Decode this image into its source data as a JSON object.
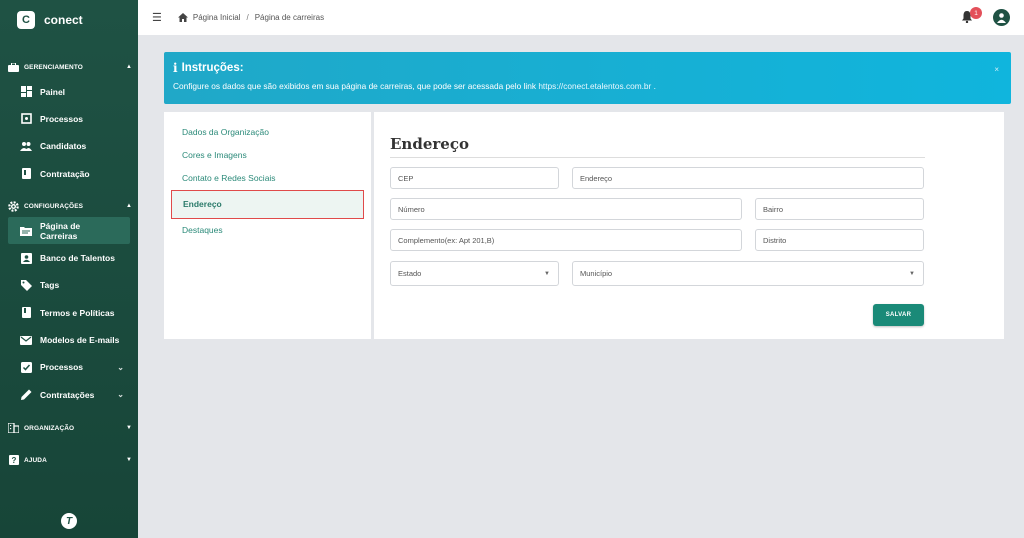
{
  "brand": {
    "letter": "C",
    "name": "conect"
  },
  "sidebar": {
    "sections": [
      {
        "label": "GERENCIAMENTO",
        "icon": "briefcase-icon"
      },
      {
        "label": "CONFIGURAÇÕES",
        "icon": "gear-icon"
      },
      {
        "label": "ORGANIZAÇÃO",
        "icon": "building-icon"
      },
      {
        "label": "AJUDA",
        "icon": "help-icon"
      }
    ],
    "management_items": [
      {
        "label": "Painel",
        "icon": "dashboard-icon"
      },
      {
        "label": "Processos",
        "icon": "process-icon"
      },
      {
        "label": "Candidatos",
        "icon": "people-icon"
      },
      {
        "label": "Contratação",
        "icon": "contract-icon"
      }
    ],
    "config_items": [
      {
        "label": "Página de Carreiras",
        "icon": "folder-icon"
      },
      {
        "label": "Banco de Talentos",
        "icon": "contact-card-icon"
      },
      {
        "label": "Tags",
        "icon": "tag-icon"
      },
      {
        "label": "Termos e Políticas",
        "icon": "book-icon"
      },
      {
        "label": "Modelos de E-mails",
        "icon": "mail-icon"
      },
      {
        "label": "Processos",
        "icon": "checkbox-icon"
      },
      {
        "label": "Contratações",
        "icon": "pen-icon"
      }
    ],
    "footer_logo": "T"
  },
  "topbar": {
    "breadcrumb_home": "Página Inicial",
    "breadcrumb_sep": "/",
    "breadcrumb_current": "Página de carreiras",
    "notification_count": "1"
  },
  "alert": {
    "title": "Instruções:",
    "text": "Configure os dados que são exibidos em sua página de carreiras, que pode ser acessada pelo link",
    "link": "https://conect.etalentos.com.br",
    "suffix": ".",
    "close": "×"
  },
  "left_menu": {
    "items": [
      "Dados da Organização",
      "Cores e Imagens",
      "Contato e Redes Sociais",
      "Endereço",
      "Destaques"
    ]
  },
  "form": {
    "title": "Endereço",
    "fields": {
      "cep": "CEP",
      "endereco": "Endereço",
      "numero": "Número",
      "bairro": "Bairro",
      "complemento": "Complemento(ex: Apt 201,B)",
      "distrito": "Distrito",
      "estado": "Estado",
      "municipio": "Município"
    },
    "save_label": "SALVAR"
  },
  "colors": {
    "sidebar": "#1f5244",
    "accent": "#1a8a78",
    "alert": "#17aed4",
    "badge": "#e3505a"
  }
}
